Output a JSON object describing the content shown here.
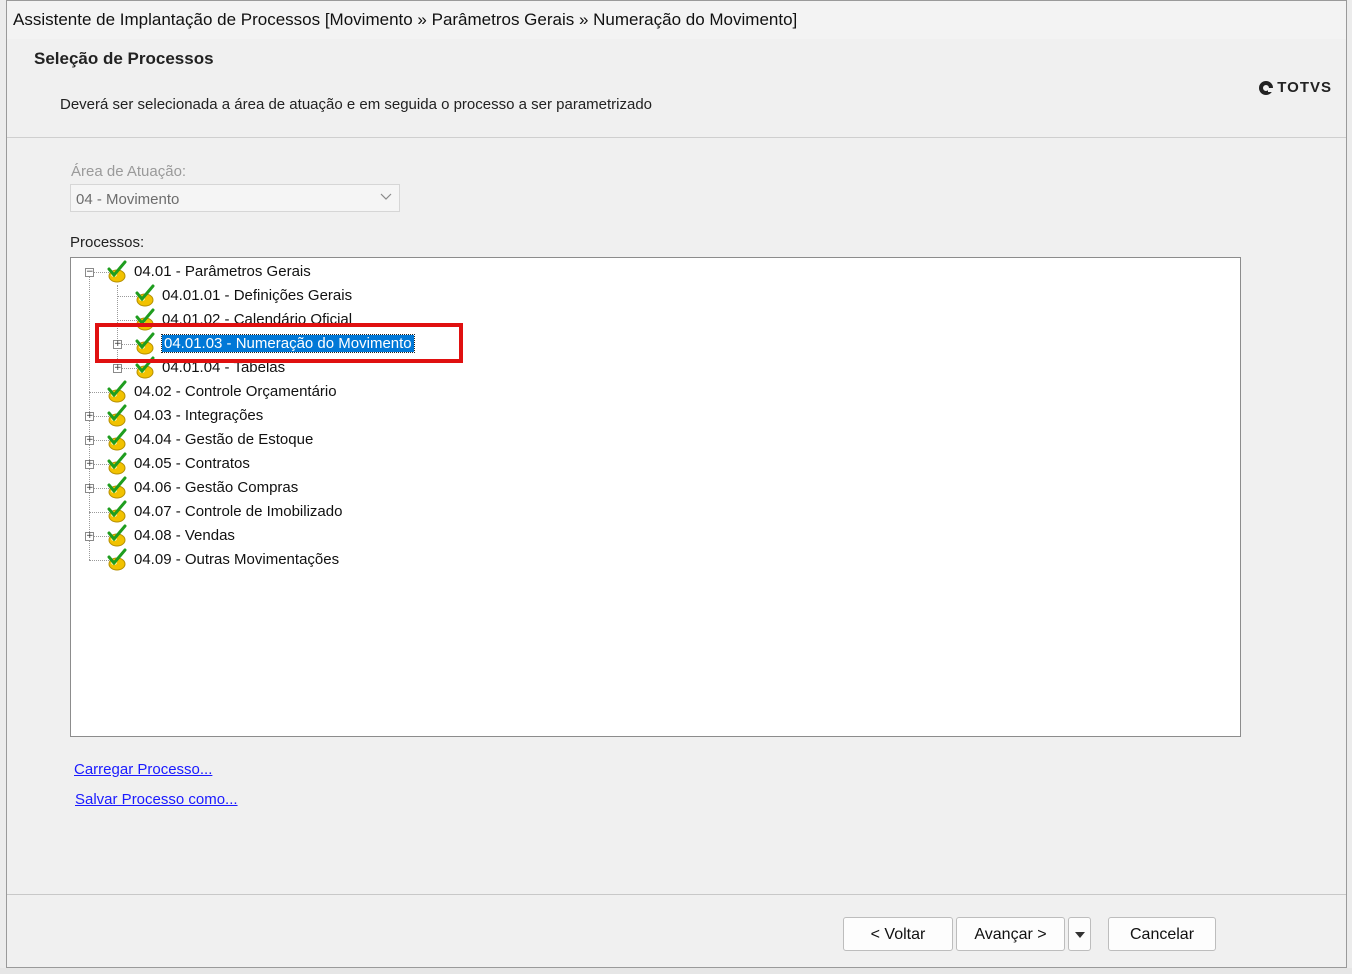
{
  "window": {
    "title": "Assistente de Implantação de Processos [Movimento » Parâmetros Gerais » Numeração do Movimento]"
  },
  "header": {
    "heading": "Seleção de Processos",
    "description": "Deverá ser selecionada a área de atuação e em seguida o processo a ser parametrizado",
    "logo": "TOTVS"
  },
  "area": {
    "label": "Área de Atuação:",
    "value": "04 - Movimento"
  },
  "processes": {
    "label": "Processos:",
    "nodes": [
      {
        "label": "04.01 - Parâmetros Gerais",
        "expander": "−",
        "selected": false
      },
      {
        "label": "04.01.01 - Definições Gerais",
        "expander": "",
        "selected": false
      },
      {
        "label": "04.01.02 - Calendário Oficial",
        "expander": "",
        "selected": false
      },
      {
        "label": "04.01.03 - Numeração do Movimento",
        "expander": "+",
        "selected": true
      },
      {
        "label": "04.01.04 - Tabelas",
        "expander": "+",
        "selected": false
      },
      {
        "label": "04.02 - Controle Orçamentário",
        "expander": "",
        "selected": false
      },
      {
        "label": "04.03 - Integrações",
        "expander": "+",
        "selected": false
      },
      {
        "label": "04.04 - Gestão de Estoque",
        "expander": "+",
        "selected": false
      },
      {
        "label": "04.05 - Contratos",
        "expander": "+",
        "selected": false
      },
      {
        "label": "04.06 - Gestão Compras",
        "expander": "+",
        "selected": false
      },
      {
        "label": "04.07 - Controle de Imobilizado",
        "expander": "",
        "selected": false
      },
      {
        "label": "04.08 - Vendas",
        "expander": "+",
        "selected": false
      },
      {
        "label": "04.09 - Outras Movimentações",
        "expander": "",
        "selected": false
      }
    ]
  },
  "links": {
    "load": "Carregar Processo...",
    "save": "Salvar Processo como..."
  },
  "buttons": {
    "back": "< Voltar",
    "next": "Avançar >",
    "cancel": "Cancelar"
  },
  "colors": {
    "selection": "#0078d7",
    "highlight_box": "#e01010",
    "link": "#1a1aff"
  }
}
